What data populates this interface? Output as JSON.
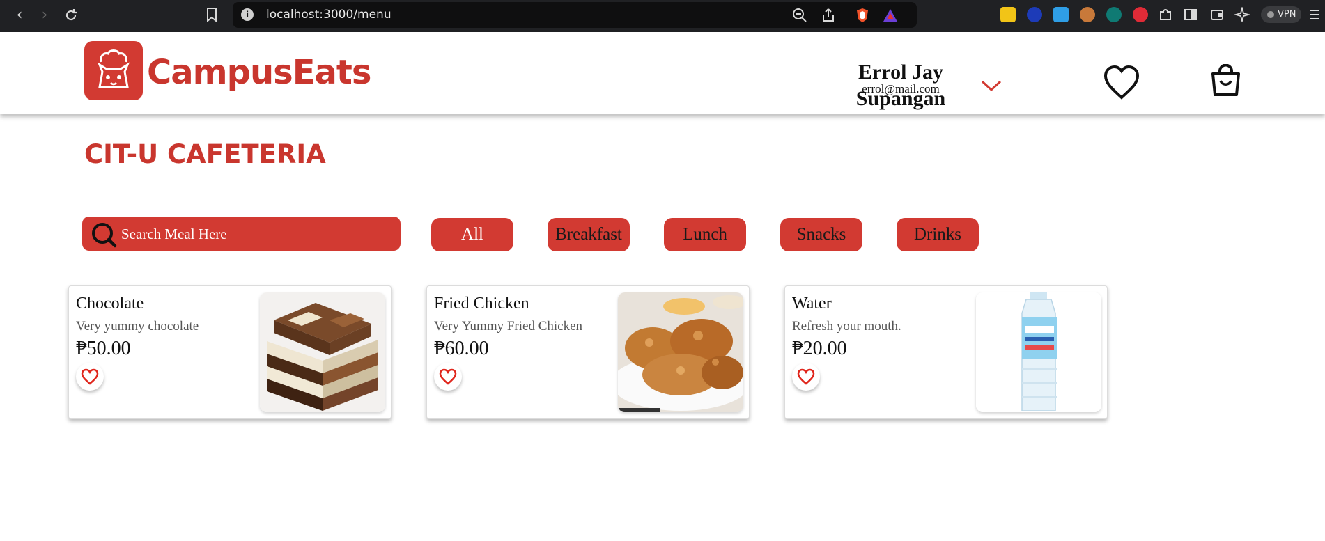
{
  "browser": {
    "url": "localhost:3000/menu",
    "vpn_label": "VPN"
  },
  "header": {
    "brand": "CampusEats",
    "user": {
      "first_name": "Errol Jay",
      "email": "errol@mail.com",
      "last_name": "Supangan"
    },
    "accent_color": "#d23a32"
  },
  "page": {
    "title": "CIT-U CAFETERIA",
    "search_placeholder": "Search Meal Here",
    "categories": [
      {
        "label": "All",
        "active": true
      },
      {
        "label": "Breakfast",
        "active": false
      },
      {
        "label": "Lunch",
        "active": false
      },
      {
        "label": "Snacks",
        "active": false
      },
      {
        "label": "Drinks",
        "active": false
      }
    ],
    "items": [
      {
        "name": "Chocolate",
        "description": "Very yummy chocolate",
        "price": "₱50.00",
        "image": "chocolate-image"
      },
      {
        "name": "Fried Chicken",
        "description": "Very Yummy Fried Chicken",
        "price": "₱60.00",
        "image": "fried-chicken-image"
      },
      {
        "name": "Water",
        "description": "Refresh your mouth.",
        "price": "₱20.00",
        "image": "water-bottle-image"
      }
    ]
  }
}
